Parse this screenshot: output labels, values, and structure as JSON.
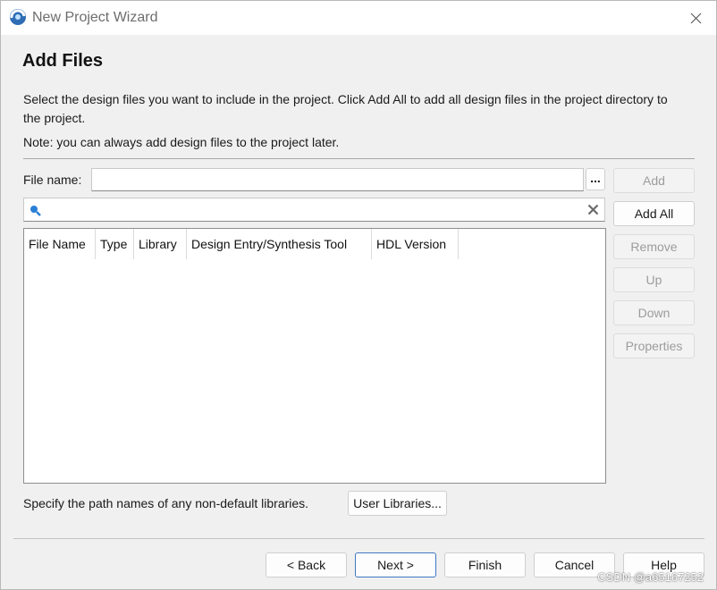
{
  "window": {
    "title": "New Project Wizard",
    "close_icon": "close-icon"
  },
  "page": {
    "heading": "Add Files",
    "description": "Select the design files you want to include in the project. Click Add All to add all design files in the project directory to the project.",
    "note": "Note: you can always add design files to the project later."
  },
  "file_name": {
    "label": "File name:",
    "value": "",
    "browse_label": "..."
  },
  "filter": {
    "value": "",
    "search_icon": "search-icon",
    "clear_icon": "clear-icon"
  },
  "table": {
    "columns": [
      "File Name",
      "Type",
      "Library",
      "Design Entry/Synthesis Tool",
      "HDL Version"
    ],
    "rows": []
  },
  "side_buttons": {
    "add": "Add",
    "add_all": "Add All",
    "remove": "Remove",
    "up": "Up",
    "down": "Down",
    "properties": "Properties"
  },
  "libraries": {
    "text": "Specify the path names of any non-default libraries.",
    "button": "User Libraries..."
  },
  "footer": {
    "back": "< Back",
    "next": "Next >",
    "finish": "Finish",
    "cancel": "Cancel",
    "help": "Help"
  },
  "watermark": "CSDN @a65167252",
  "colors": {
    "accent": "#3f78c2",
    "window_bg": "#f0f0f0",
    "disabled_text": "#9c9c9c"
  }
}
